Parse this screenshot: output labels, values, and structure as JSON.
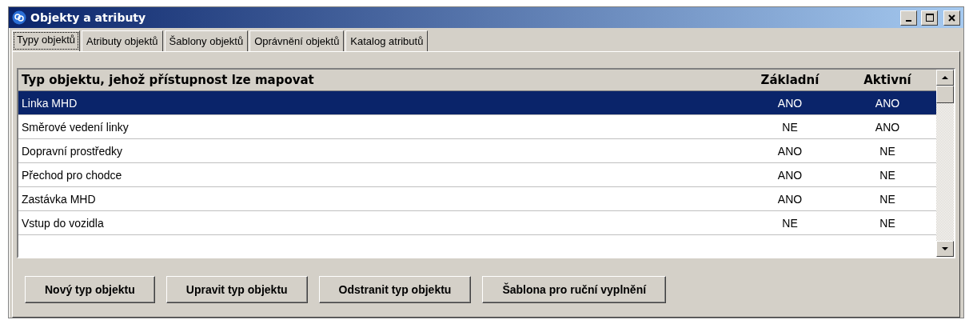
{
  "window": {
    "title": "Objekty a atributy"
  },
  "tabs": [
    {
      "label": "Typy objektů",
      "selected": true
    },
    {
      "label": "Atributy objektů",
      "selected": false
    },
    {
      "label": "Šablony objektů",
      "selected": false
    },
    {
      "label": "Oprávnění objektů",
      "selected": false
    },
    {
      "label": "Katalog atributů",
      "selected": false
    }
  ],
  "table": {
    "columns": [
      "Typ objektu, jehož přístupnost lze mapovat",
      "Základní",
      "Aktivní"
    ],
    "rows": [
      {
        "cells": [
          "Linka MHD",
          "ANO",
          "ANO"
        ],
        "selected": true
      },
      {
        "cells": [
          "Směrové vedení linky",
          "NE",
          "ANO"
        ],
        "selected": false
      },
      {
        "cells": [
          "Dopravní prostředky",
          "ANO",
          "NE"
        ],
        "selected": false
      },
      {
        "cells": [
          "Přechod pro chodce",
          "ANO",
          "NE"
        ],
        "selected": false
      },
      {
        "cells": [
          "Zastávka MHD",
          "ANO",
          "NE"
        ],
        "selected": false
      },
      {
        "cells": [
          "Vstup do vozidla",
          "NE",
          "NE"
        ],
        "selected": false
      }
    ]
  },
  "buttons": [
    "Nový typ objektu",
    "Upravit typ objektu",
    "Odstranit typ objektu",
    "Šablona pro ruční vyplnění"
  ]
}
